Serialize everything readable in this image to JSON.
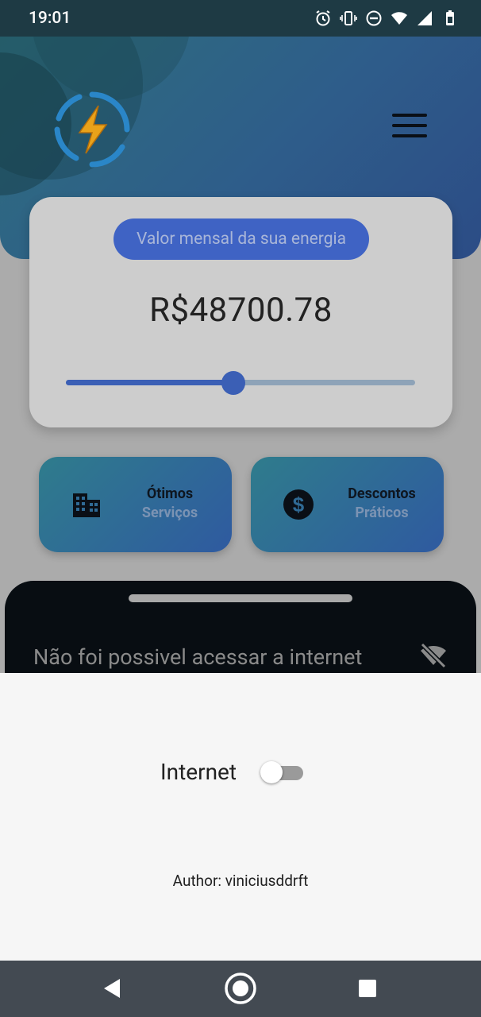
{
  "status_bar": {
    "time": "19:01",
    "icons": [
      "alarm-icon",
      "vibrate-icon",
      "do-not-disturb-icon",
      "wifi-icon",
      "signal-icon",
      "battery-icon"
    ]
  },
  "header": {
    "logo": "lightning-logo",
    "menu_icon": "hamburger-menu-icon"
  },
  "energy_card": {
    "label": "Valor mensal da sua energia",
    "value": "R$48700.78",
    "slider_fraction": 0.48
  },
  "features": [
    {
      "icon": "building-icon",
      "line1": "Ótimos",
      "line2": "Serviços"
    },
    {
      "icon": "dollar-coin-icon",
      "line1": "Descontos",
      "line2": "Práticos"
    }
  ],
  "bottom_sheet": {
    "message": "Não foi possivel acessar a internet",
    "icon": "wifi-off-icon"
  },
  "panel": {
    "toggle_label": "Internet",
    "toggle_on": false,
    "author": "Author: viniciusddrft"
  },
  "nav_bar": {
    "buttons": [
      "back-icon",
      "home-icon",
      "recents-icon"
    ]
  },
  "colors": {
    "accent": "#3b5fb5",
    "header_gradient_start": "#2f6e7d",
    "header_gradient_end": "#2c4c86"
  }
}
